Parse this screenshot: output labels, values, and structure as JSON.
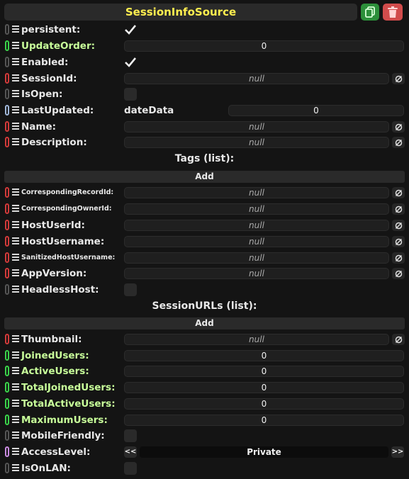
{
  "header": {
    "title": "SessionInfoSource"
  },
  "colors": {
    "bool": "#9a9a9a",
    "int": "#3ad24a",
    "string": "#d13a3a",
    "datetime": "#9fb6d8",
    "enum": "#c98be0"
  },
  "fields": {
    "persistent": "persistent:",
    "update_order": {
      "label": "UpdateOrder:",
      "value": "0"
    },
    "enabled": "Enabled:",
    "session_id": {
      "label": "SessionId:",
      "value": "null"
    },
    "is_open": "IsOpen:",
    "last_updated": {
      "label": "LastUpdated:",
      "date_label": "dateData",
      "value": "0"
    },
    "name": {
      "label": "Name:",
      "value": "null"
    },
    "description": {
      "label": "Description:",
      "value": "null"
    },
    "tags_title": "Tags (list):",
    "tags_add": "Add",
    "corresponding_record_id": {
      "label": "CorrespondingRecordId:",
      "value": "null"
    },
    "corresponding_owner_id": {
      "label": "CorrespondingOwnerId:",
      "value": "null"
    },
    "host_user_id": {
      "label": "HostUserId:",
      "value": "null"
    },
    "host_username": {
      "label": "HostUsername:",
      "value": "null"
    },
    "sanitized_host_username": {
      "label": "SanitizedHostUsername:",
      "value": "null"
    },
    "app_version": {
      "label": "AppVersion:",
      "value": "null"
    },
    "headless_host": "HeadlessHost:",
    "urls_title": "SessionURLs (list):",
    "urls_add": "Add",
    "thumbnail": {
      "label": "Thumbnail:",
      "value": "null"
    },
    "joined_users": {
      "label": "JoinedUsers:",
      "value": "0"
    },
    "active_users": {
      "label": "ActiveUsers:",
      "value": "0"
    },
    "total_joined_users": {
      "label": "TotalJoinedUsers:",
      "value": "0"
    },
    "total_active_users": {
      "label": "TotalActiveUsers:",
      "value": "0"
    },
    "maximum_users": {
      "label": "MaximumUsers:",
      "value": "0"
    },
    "mobile_friendly": "MobileFriendly:",
    "access_level": {
      "label": "AccessLevel:",
      "value": "Private",
      "prev": "<<",
      "next": ">>"
    },
    "is_on_lan": "IsOnLAN:"
  }
}
